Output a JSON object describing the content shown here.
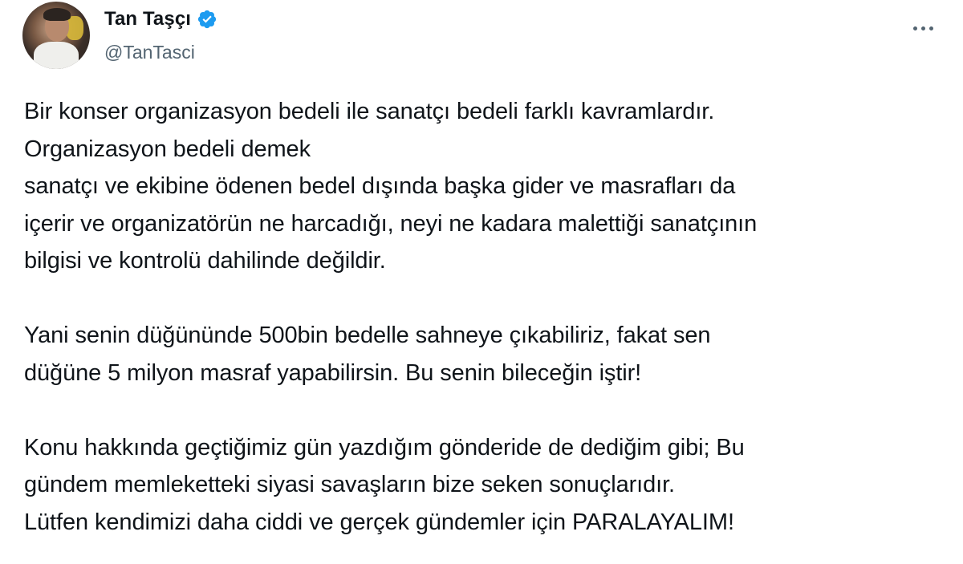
{
  "author": {
    "display_name": "Tan Taşçı",
    "handle": "@TanTasci",
    "verified": true,
    "verified_icon": "verified-badge-icon",
    "avatar_icon": "profile-avatar"
  },
  "actions": {
    "more_icon": "more-options-icon"
  },
  "colors": {
    "text_primary": "#0f1419",
    "text_secondary": "#536471",
    "verified_blue": "#1d9bf0"
  },
  "tweet": {
    "paragraphs": [
      {
        "lines": [
          "Bir konser organizasyon bedeli ile sanatçı bedeli farklı kavramlardır.",
          "Organizasyon bedeli demek",
          "sanatçı ve ekibine ödenen bedel dışında başka gider ve masrafları da",
          "içerir ve organizatörün ne harcadığı, neyi ne kadara malettiği sanatçının",
          "bilgisi ve kontrolü dahilinde değildir."
        ]
      },
      {
        "lines": [
          "Yani senin düğününde 500bin bedelle sahneye çıkabiliriz, fakat sen",
          "düğüne 5 milyon masraf yapabilirsin. Bu senin bileceğin iştir!"
        ]
      },
      {
        "lines": [
          "Konu hakkında geçtiğimiz gün yazdığım gönderide de dediğim gibi; Bu",
          "gündem memleketteki siyasi savaşların bize seken sonuçlarıdır.",
          "Lütfen kendimizi daha ciddi ve gerçek gündemler için PARALAYALIM!"
        ]
      }
    ]
  }
}
